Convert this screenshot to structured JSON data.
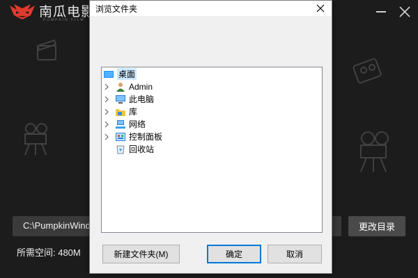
{
  "installer": {
    "brand_name": "南瓜电影",
    "brand_subtitle": "PUMPKIN FILM",
    "install_path": "C:\\PumpkinWindo",
    "change_dir_button": "更改目录",
    "required_space": "所需空间: 480M"
  },
  "dialog": {
    "title": "浏览文件夹",
    "tree": [
      {
        "label": "桌面",
        "icon": "desktop-icon",
        "expandable": false,
        "selected": true
      },
      {
        "label": "Admin",
        "icon": "user-icon",
        "expandable": true,
        "selected": false
      },
      {
        "label": "此电脑",
        "icon": "computer-icon",
        "expandable": true,
        "selected": false
      },
      {
        "label": "库",
        "icon": "library-folder-icon",
        "expandable": true,
        "selected": false
      },
      {
        "label": "网络",
        "icon": "network-icon",
        "expandable": true,
        "selected": false
      },
      {
        "label": "控制面板",
        "icon": "control-panel-icon",
        "expandable": true,
        "selected": false
      },
      {
        "label": "回收站",
        "icon": "recycle-bin-icon",
        "expandable": false,
        "selected": false
      }
    ],
    "new_folder_button": "新建文件夹(M)",
    "ok_button": "确定",
    "cancel_button": "取消"
  },
  "colors": {
    "installer_bg": "#1c1c1c",
    "selection": "#cce8ff",
    "default_button_border": "#0078d7"
  }
}
